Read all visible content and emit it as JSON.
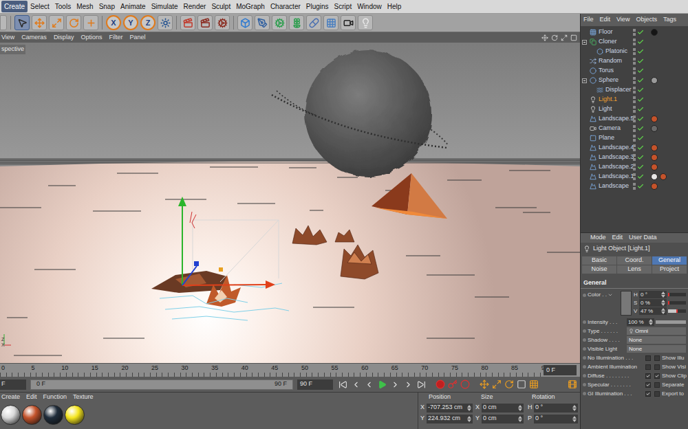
{
  "menu_bar": {
    "items": [
      {
        "label": "Create",
        "selected": true
      },
      {
        "label": "Select",
        "selected": false
      },
      {
        "label": "Tools",
        "selected": false
      },
      {
        "label": "Mesh",
        "selected": false
      },
      {
        "label": "Snap",
        "selected": false
      },
      {
        "label": "Animate",
        "selected": false
      },
      {
        "label": "Simulate",
        "selected": false
      },
      {
        "label": "Render",
        "selected": false
      },
      {
        "label": "Sculpt",
        "selected": false
      },
      {
        "label": "MoGraph",
        "selected": false
      },
      {
        "label": "Character",
        "selected": false
      },
      {
        "label": "Plugins",
        "selected": false
      },
      {
        "label": "Script",
        "selected": false
      },
      {
        "label": "Window",
        "selected": false
      },
      {
        "label": "Help",
        "selected": false
      }
    ]
  },
  "toolbar": {
    "tools": [
      {
        "kind": "pointer",
        "selected": true
      },
      {
        "kind": "move",
        "selected": false
      },
      {
        "kind": "scale",
        "selected": false
      },
      {
        "kind": "rotate",
        "selected": false
      },
      {
        "kind": "transform",
        "selected": false
      }
    ],
    "axes": [
      {
        "label": "X",
        "on": true
      },
      {
        "label": "Y",
        "on": true
      },
      {
        "label": "Z",
        "on": true
      }
    ],
    "render": [
      {
        "kind": "coord"
      },
      {
        "kind": "render_view"
      },
      {
        "kind": "render_picture"
      },
      {
        "kind": "render_settings"
      }
    ],
    "create": [
      {
        "kind": "cube"
      },
      {
        "kind": "pen"
      },
      {
        "kind": "cloner"
      },
      {
        "kind": "subdivision"
      },
      {
        "kind": "deformer"
      },
      {
        "kind": "floor"
      },
      {
        "kind": "camera"
      },
      {
        "kind": "light"
      }
    ]
  },
  "viewport": {
    "menu": [
      "View",
      "Cameras",
      "Display",
      "Options",
      "Filter",
      "Panel"
    ],
    "camera_label": "spective",
    "axis_labels": [
      "Z",
      "X"
    ]
  },
  "timeline": {
    "ruler": [
      "0",
      "5",
      "10",
      "15",
      "20",
      "25",
      "30",
      "35",
      "40",
      "45",
      "50",
      "55",
      "60",
      "65",
      "70",
      "75",
      "80",
      "85",
      "90"
    ],
    "current_frame": "0 F",
    "start_field": "F",
    "range_start": "0 F",
    "range_end": "90 F",
    "end_field": "90 F"
  },
  "material_manager": {
    "menu": [
      "Create",
      "Edit",
      "Function",
      "Texture"
    ],
    "materials": [
      {
        "color": "#d9d9d9"
      },
      {
        "color": "#c4532b"
      },
      {
        "color": "#1f2c3a"
      },
      {
        "color": "#f5e51e"
      }
    ]
  },
  "coordinates": {
    "columns": [
      "Position",
      "Size",
      "Rotation"
    ],
    "rows": [
      {
        "axis": "X",
        "position": "-707.253 cm",
        "size_axis": "X",
        "size": "0 cm",
        "rot_axis": "H",
        "rotation": "0 °"
      },
      {
        "axis": "Y",
        "position": "224.932 cm",
        "size_axis": "Y",
        "size": "0 cm",
        "rot_axis": "P",
        "rotation": "0 °"
      }
    ]
  },
  "object_manager": {
    "menu": [
      "File",
      "Edit",
      "View",
      "Objects",
      "Tags"
    ],
    "objects": [
      {
        "name": "Floor",
        "kind": "floor",
        "depth": 0,
        "expanded": false,
        "selected": false,
        "enabled": true,
        "tags": [
          "#151515"
        ]
      },
      {
        "name": "Cloner",
        "kind": "cloner",
        "depth": 0,
        "expanded": true,
        "selected": false,
        "enabled": true,
        "tags": []
      },
      {
        "name": "Platonic",
        "kind": "platonic",
        "depth": 1,
        "expanded": false,
        "selected": false,
        "enabled": true,
        "tags": []
      },
      {
        "name": "Random",
        "kind": "random",
        "depth": 0,
        "expanded": false,
        "selected": false,
        "enabled": true,
        "tags": []
      },
      {
        "name": "Torus",
        "kind": "torus",
        "depth": 0,
        "expanded": false,
        "selected": false,
        "enabled": true,
        "tags": []
      },
      {
        "name": "Sphere",
        "kind": "sphere",
        "depth": 0,
        "expanded": true,
        "selected": false,
        "enabled": true,
        "tags": [
          "#9a9a9a"
        ]
      },
      {
        "name": "Displacer",
        "kind": "displacer",
        "depth": 1,
        "expanded": false,
        "selected": false,
        "enabled": true,
        "tags": []
      },
      {
        "name": "Light.1",
        "kind": "light",
        "depth": 0,
        "expanded": false,
        "selected": true,
        "enabled": true,
        "tags": []
      },
      {
        "name": "Light",
        "kind": "light",
        "depth": 0,
        "expanded": false,
        "selected": false,
        "enabled": true,
        "tags": []
      },
      {
        "name": "Landscape.5",
        "kind": "landscape",
        "depth": 0,
        "expanded": false,
        "selected": false,
        "enabled": true,
        "tags": [
          "#c4532b"
        ]
      },
      {
        "name": "Camera",
        "kind": "camera",
        "depth": 0,
        "expanded": false,
        "selected": false,
        "enabled": true,
        "tags": [
          "#6a6a6a"
        ]
      },
      {
        "name": "Plane",
        "kind": "plane",
        "depth": 0,
        "expanded": false,
        "selected": false,
        "enabled": true,
        "tags": []
      },
      {
        "name": "Landscape.4",
        "kind": "landscape",
        "depth": 0,
        "expanded": false,
        "selected": false,
        "enabled": true,
        "tags": [
          "#c4532b"
        ]
      },
      {
        "name": "Landscape.3",
        "kind": "landscape",
        "depth": 0,
        "expanded": false,
        "selected": false,
        "enabled": true,
        "tags": [
          "#c4532b"
        ]
      },
      {
        "name": "Landscape.2",
        "kind": "landscape",
        "depth": 0,
        "expanded": false,
        "selected": false,
        "enabled": true,
        "tags": [
          "#c4532b"
        ]
      },
      {
        "name": "Landscape.1",
        "kind": "landscape",
        "depth": 0,
        "expanded": false,
        "selected": false,
        "enabled": true,
        "tags": [
          "#e6e6e6",
          "#c4532b"
        ]
      },
      {
        "name": "Landscape",
        "kind": "landscape",
        "depth": 0,
        "expanded": false,
        "selected": false,
        "enabled": true,
        "tags": [
          "#c4532b"
        ]
      }
    ]
  },
  "attribute_manager": {
    "menu": [
      "Mode",
      "Edit",
      "User Data"
    ],
    "title": "Light Object [Light.1]",
    "tabs": [
      {
        "label": "Basic",
        "selected": false
      },
      {
        "label": "Coord.",
        "selected": false
      },
      {
        "label": "General",
        "selected": true
      },
      {
        "label": "Noise",
        "selected": false
      },
      {
        "label": "Lens",
        "selected": false
      },
      {
        "label": "Project",
        "selected": false
      }
    ],
    "section": "General",
    "color": {
      "label": "Color . .",
      "channels": [
        {
          "label": "H",
          "value": "0 °",
          "level": 0
        },
        {
          "label": "S",
          "value": "0 %",
          "level": 0
        },
        {
          "label": "V",
          "value": "47 %",
          "level": 0.47
        }
      ]
    },
    "rows": [
      {
        "kind": "slider",
        "label": "Intensity . . .",
        "value": "100 %",
        "level": 1
      },
      {
        "kind": "dropdown",
        "label": "Type . . . . . .",
        "value": "Omni"
      },
      {
        "kind": "dropdown",
        "label": "Shadow . . . .",
        "value": "None"
      },
      {
        "kind": "dropdown",
        "label": "Visible Light",
        "value": "None"
      },
      {
        "kind": "checkbox",
        "label": "No Illumination . . .",
        "checked": false,
        "right": {
          "label": "Show Illu",
          "checked": false
        }
      },
      {
        "kind": "checkbox",
        "label": "Ambient Illumination",
        "checked": false,
        "right": {
          "label": "Show Visi",
          "checked": false
        }
      },
      {
        "kind": "checkbox",
        "label": "Diffuse . . . . . . . .",
        "checked": true,
        "right": {
          "label": "Show Clip",
          "checked": true
        }
      },
      {
        "kind": "checkbox",
        "label": "Specular . . . . . . .",
        "checked": true,
        "right": {
          "label": "Separate",
          "checked": false
        }
      },
      {
        "kind": "checkbox",
        "label": "GI Illumination . . .",
        "checked": true,
        "right": {
          "label": "Export to",
          "checked": false
        }
      }
    ]
  }
}
